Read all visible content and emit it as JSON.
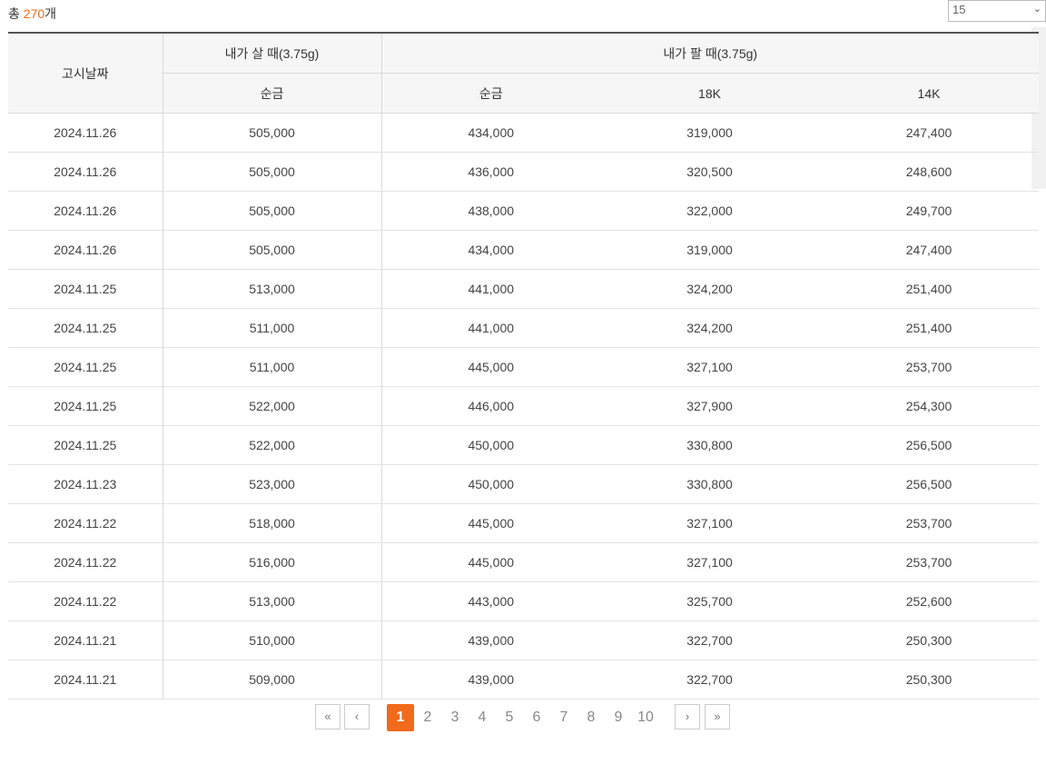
{
  "summary": {
    "prefix": "총 ",
    "count": "270",
    "suffix": "개"
  },
  "page_size": {
    "value": "15"
  },
  "table": {
    "date_header": "고시날짜",
    "buy_header": "내가 살 때(3.75g)",
    "sell_header": "내가 팔 때(3.75g)",
    "buy_sub": "순금",
    "sell_subs": [
      "순금",
      "18K",
      "14K"
    ],
    "rows": [
      [
        "2024.11.26",
        "505,000",
        "434,000",
        "319,000",
        "247,400"
      ],
      [
        "2024.11.26",
        "505,000",
        "436,000",
        "320,500",
        "248,600"
      ],
      [
        "2024.11.26",
        "505,000",
        "438,000",
        "322,000",
        "249,700"
      ],
      [
        "2024.11.26",
        "505,000",
        "434,000",
        "319,000",
        "247,400"
      ],
      [
        "2024.11.25",
        "513,000",
        "441,000",
        "324,200",
        "251,400"
      ],
      [
        "2024.11.25",
        "511,000",
        "441,000",
        "324,200",
        "251,400"
      ],
      [
        "2024.11.25",
        "511,000",
        "445,000",
        "327,100",
        "253,700"
      ],
      [
        "2024.11.25",
        "522,000",
        "446,000",
        "327,900",
        "254,300"
      ],
      [
        "2024.11.25",
        "522,000",
        "450,000",
        "330,800",
        "256,500"
      ],
      [
        "2024.11.23",
        "523,000",
        "450,000",
        "330,800",
        "256,500"
      ],
      [
        "2024.11.22",
        "518,000",
        "445,000",
        "327,100",
        "253,700"
      ],
      [
        "2024.11.22",
        "516,000",
        "445,000",
        "327,100",
        "253,700"
      ],
      [
        "2024.11.22",
        "513,000",
        "443,000",
        "325,700",
        "252,600"
      ],
      [
        "2024.11.21",
        "510,000",
        "439,000",
        "322,700",
        "250,300"
      ],
      [
        "2024.11.21",
        "509,000",
        "439,000",
        "322,700",
        "250,300"
      ]
    ]
  },
  "pagination": {
    "first": "«",
    "prev": "‹",
    "next": "›",
    "last": "»",
    "pages": [
      "1",
      "2",
      "3",
      "4",
      "5",
      "6",
      "7",
      "8",
      "9",
      "10"
    ],
    "current": "1"
  },
  "colors": {
    "accent": "#f26a1b"
  }
}
